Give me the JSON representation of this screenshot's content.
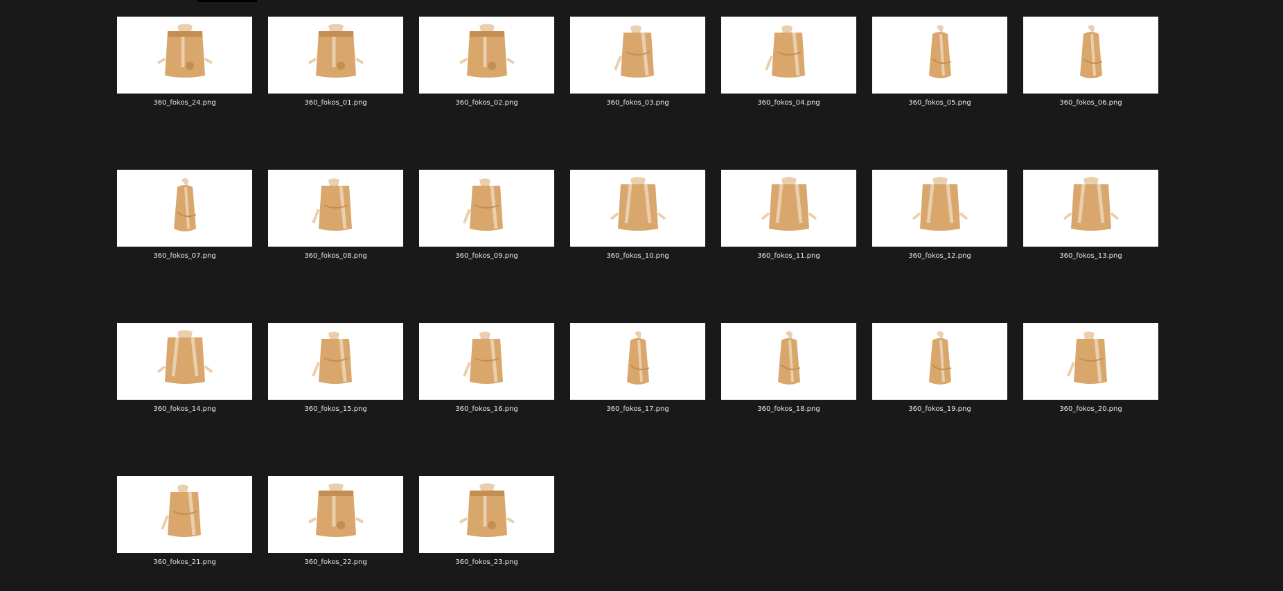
{
  "files": [
    {
      "name": "360_fokos_24.png",
      "icon": "backpack-front-icon"
    },
    {
      "name": "360_fokos_01.png",
      "icon": "backpack-front-icon"
    },
    {
      "name": "360_fokos_02.png",
      "icon": "backpack-front-icon"
    },
    {
      "name": "360_fokos_03.png",
      "icon": "backpack-angle-icon"
    },
    {
      "name": "360_fokos_04.png",
      "icon": "backpack-angle-icon"
    },
    {
      "name": "360_fokos_05.png",
      "icon": "backpack-side-icon"
    },
    {
      "name": "360_fokos_06.png",
      "icon": "backpack-side-icon"
    },
    {
      "name": "360_fokos_07.png",
      "icon": "backpack-side-icon"
    },
    {
      "name": "360_fokos_08.png",
      "icon": "backpack-angle-icon"
    },
    {
      "name": "360_fokos_09.png",
      "icon": "backpack-angle-icon"
    },
    {
      "name": "360_fokos_10.png",
      "icon": "backpack-back-icon"
    },
    {
      "name": "360_fokos_11.png",
      "icon": "backpack-back-icon"
    },
    {
      "name": "360_fokos_12.png",
      "icon": "backpack-back-icon"
    },
    {
      "name": "360_fokos_13.png",
      "icon": "backpack-back-icon"
    },
    {
      "name": "360_fokos_14.png",
      "icon": "backpack-back-icon"
    },
    {
      "name": "360_fokos_15.png",
      "icon": "backpack-angle-icon"
    },
    {
      "name": "360_fokos_16.png",
      "icon": "backpack-angle-icon"
    },
    {
      "name": "360_fokos_17.png",
      "icon": "backpack-side-icon"
    },
    {
      "name": "360_fokos_18.png",
      "icon": "backpack-side-icon"
    },
    {
      "name": "360_fokos_19.png",
      "icon": "backpack-side-icon"
    },
    {
      "name": "360_fokos_20.png",
      "icon": "backpack-angle-icon"
    },
    {
      "name": "360_fokos_21.png",
      "icon": "backpack-angle-icon"
    },
    {
      "name": "360_fokos_22.png",
      "icon": "backpack-front-icon"
    },
    {
      "name": "360_fokos_23.png",
      "icon": "backpack-front-icon"
    }
  ],
  "colors": {
    "background": "#191919",
    "thumbnail_bg": "#ffffff",
    "bag": "#d9a66b",
    "bag_shade": "#c48d52",
    "strap": "#e9cfae",
    "label_text": "#e8e8e8"
  }
}
